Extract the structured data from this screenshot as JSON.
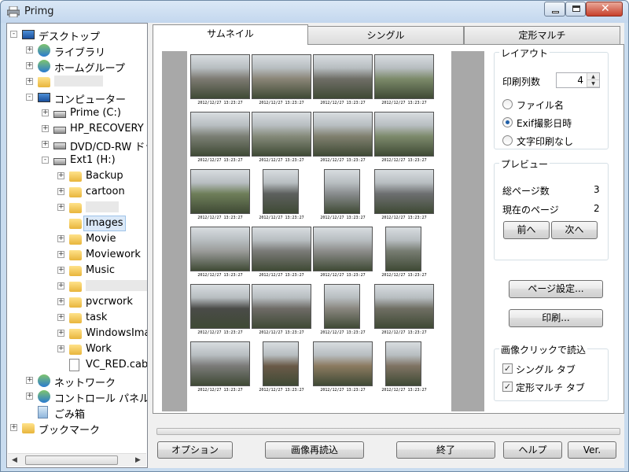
{
  "window": {
    "title": "Primg"
  },
  "tree": {
    "items": [
      {
        "label": "デスクトップ",
        "icon": "desktop-icon"
      },
      {
        "label": "ライブラリ",
        "icon": "library-icon"
      },
      {
        "label": "ホームグループ",
        "icon": "homegroup-icon"
      },
      {
        "label": "",
        "icon": "user-folder-icon"
      },
      {
        "label": "コンピューター",
        "icon": "computer-icon"
      },
      {
        "label": "Prime (C:)",
        "icon": "drive-icon"
      },
      {
        "label": "HP_RECOVERY (D",
        "icon": "drive-icon"
      },
      {
        "label": "DVD/CD-RW ドラ",
        "icon": "dvd-drive-icon"
      },
      {
        "label": "Ext1 (H:)",
        "icon": "drive-icon"
      },
      {
        "label": "Backup",
        "icon": "folder-icon"
      },
      {
        "label": "cartoon",
        "icon": "folder-icon"
      },
      {
        "label": "",
        "icon": "folder-icon"
      },
      {
        "label": "Images",
        "icon": "folder-icon"
      },
      {
        "label": "Movie",
        "icon": "folder-icon"
      },
      {
        "label": "Moviework",
        "icon": "folder-icon"
      },
      {
        "label": "Music",
        "icon": "folder-icon"
      },
      {
        "label": "",
        "icon": "shared-folder-icon"
      },
      {
        "label": "pvcrwork",
        "icon": "folder-icon"
      },
      {
        "label": "task",
        "icon": "folder-icon"
      },
      {
        "label": "WindowsImag",
        "icon": "folder-icon"
      },
      {
        "label": "Work",
        "icon": "folder-icon"
      },
      {
        "label": "VC_RED.cab",
        "icon": "cab-file-icon"
      },
      {
        "label": "ネットワーク",
        "icon": "network-icon"
      },
      {
        "label": "コントロール パネル",
        "icon": "control-panel-icon"
      },
      {
        "label": "ごみ箱",
        "icon": "recycle-bin-icon"
      },
      {
        "label": "ブックマーク",
        "icon": "bookmark-folder-icon"
      }
    ]
  },
  "tabs": [
    "サムネイル",
    "シングル",
    "定形マルチ"
  ],
  "thumbnails": {
    "caption": "2012/12/27 13:23:27",
    "colors": [
      "#7d7a72",
      "#8a8577",
      "#6f6e66",
      "#7c8a6a",
      "#7b7f74",
      "#858a7a",
      "#80806f",
      "#7d8a6c",
      "#6f7f5a",
      "#5d605e",
      "#898c8e",
      "#6d6f70",
      "#9a9b99",
      "#7a7a77",
      "#8c8c8a",
      "#777c72",
      "#4a4b48",
      "#6e6b66",
      "#8a8780",
      "#6f6e63",
      "#7a7a78",
      "#6a5a48",
      "#8b7a60",
      "#7f7363"
    ]
  },
  "layout_group": {
    "title": "レイアウト",
    "columns_label": "印刷列数",
    "columns_value": "4",
    "radio_filename": "ファイル名",
    "radio_exif": "Exif撮影日時",
    "radio_none": "文字印刷なし"
  },
  "preview_group": {
    "title": "プレビュー",
    "total_pages_label": "総ページ数",
    "total_pages_value": "3",
    "current_page_label": "現在のページ",
    "current_page_value": "2",
    "prev_label": "前へ",
    "next_label": "次へ"
  },
  "page_setup_label": "ページ設定...",
  "print_label": "印刷...",
  "click_group": {
    "title": "画像クリックで読込",
    "single_tab": "シングル タブ",
    "multi_tab": "定形マルチ タブ"
  },
  "bottom": {
    "options": "オプション",
    "reload": "画像再読込",
    "exit": "終了",
    "help": "ヘルプ",
    "version": "Ver."
  }
}
